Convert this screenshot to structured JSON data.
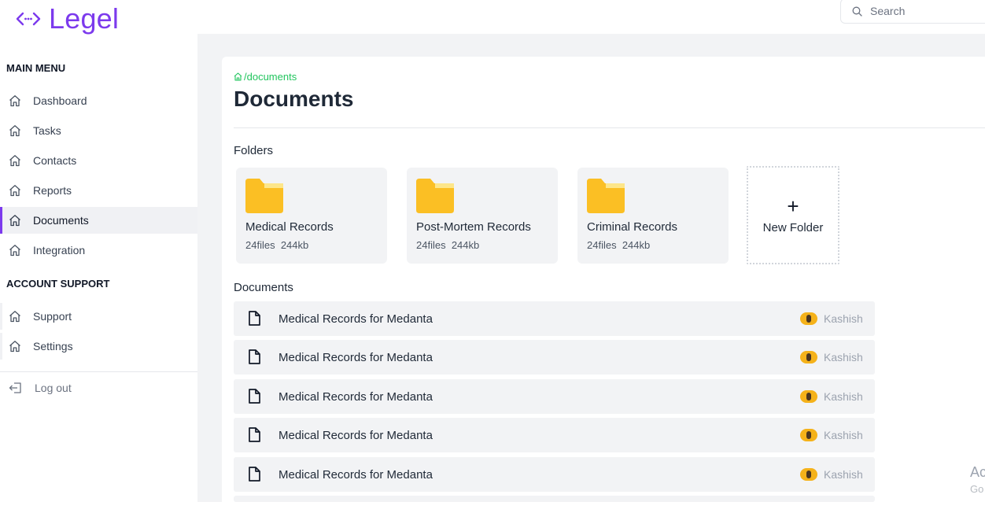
{
  "app": {
    "logo_text": "Legel"
  },
  "search": {
    "placeholder": "Search"
  },
  "sidebar": {
    "main_menu_title": "MAIN MENU",
    "main_items": [
      {
        "label": "Dashboard",
        "icon": "home-icon"
      },
      {
        "label": "Tasks",
        "icon": "home-icon"
      },
      {
        "label": "Contacts",
        "icon": "home-icon"
      },
      {
        "label": "Reports",
        "icon": "home-icon"
      },
      {
        "label": "Documents",
        "icon": "home-icon",
        "active": true
      },
      {
        "label": "Integration",
        "icon": "home-icon"
      }
    ],
    "support_title": "ACCOUNT SUPPORT",
    "support_items": [
      {
        "label": "Support",
        "icon": "home-icon"
      },
      {
        "label": "Settings",
        "icon": "home-icon"
      }
    ],
    "logout_label": "Log out"
  },
  "main": {
    "breadcrumb": "/documents",
    "title": "Documents",
    "folders_heading": "Folders",
    "folders": [
      {
        "name": "Medical Records",
        "files": "24files",
        "size": "244kb"
      },
      {
        "name": "Post-Mortem Records",
        "files": "24files",
        "size": "244kb"
      },
      {
        "name": "Criminal Records",
        "files": "24files",
        "size": "244kb"
      }
    ],
    "new_folder_symbol": "+",
    "new_folder_label": "New Folder",
    "documents_heading": "Documents",
    "documents": [
      {
        "name": "Medical Records for Medanta",
        "owner": "Kashish"
      },
      {
        "name": "Medical Records for Medanta",
        "owner": "Kashish"
      },
      {
        "name": "Medical Records for Medanta",
        "owner": "Kashish"
      },
      {
        "name": "Medical Records for Medanta",
        "owner": "Kashish"
      },
      {
        "name": "Medical Records for Medanta",
        "owner": "Kashish"
      }
    ]
  },
  "watermark": {
    "line1": "Ac",
    "line2": "Go"
  },
  "colors": {
    "accent": "#7c3aed",
    "breadcrumb": "#22c55e",
    "folder": "#fbbf24",
    "panel": "#f2f3f5"
  }
}
